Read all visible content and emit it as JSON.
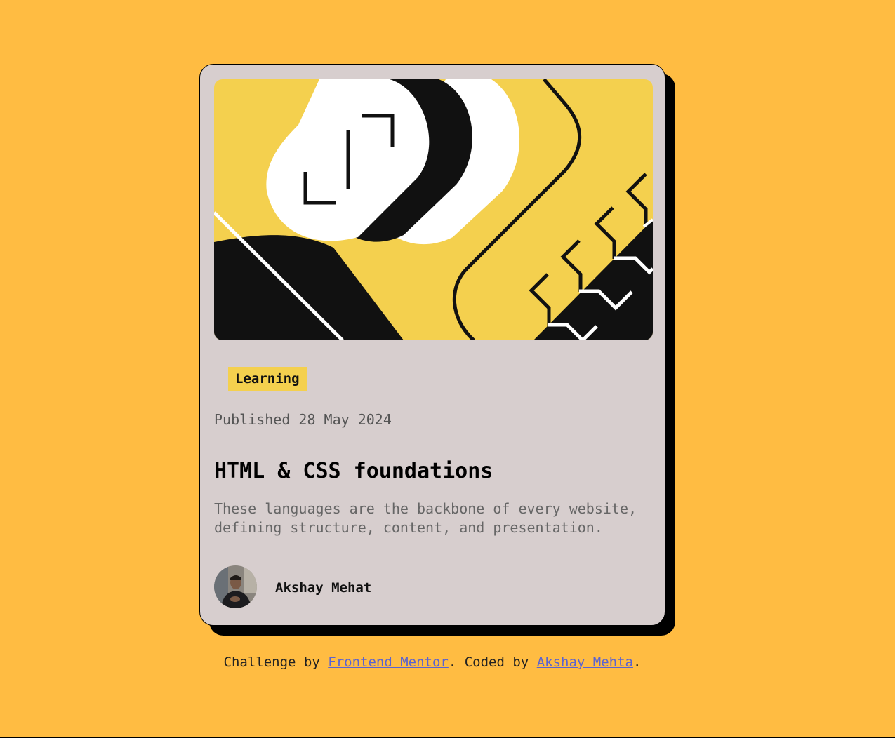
{
  "colors": {
    "page_background": "#FFBC42",
    "card_background": "#D7CECE",
    "tag_background": "#F4D04E",
    "link": "#5B63D0"
  },
  "card": {
    "image_icon": "illustration-image",
    "tag": "Learning",
    "published": "Published 28 May 2024",
    "title": "HTML & CSS foundations",
    "description": "These languages are the backbone of every website, defining structure, content, and presentation.",
    "author": {
      "name": "Akshay Mehat",
      "avatar_icon": "avatar-photo"
    }
  },
  "footer": {
    "prefix": "Challenge by ",
    "link1": "Frontend Mentor",
    "middle": ". Coded by ",
    "link2": "Akshay Mehta",
    "suffix": "."
  }
}
